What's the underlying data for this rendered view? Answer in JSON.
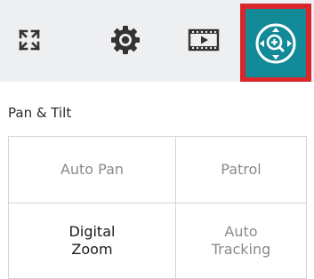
{
  "toolbar": {
    "buttons": [
      {
        "id": "fullscreen",
        "icon": "fullscreen-icon"
      },
      {
        "id": "settings",
        "icon": "gear-icon"
      },
      {
        "id": "video",
        "icon": "video-player-icon"
      },
      {
        "id": "ptz",
        "icon": "ptz-zoom-icon",
        "selected": true
      }
    ],
    "colors": {
      "background": "#edeff0",
      "icon": "#333333",
      "selected_fill": "#128a98",
      "selected_border": "#d9262c"
    }
  },
  "panel": {
    "title": "Pan & Tilt",
    "options": [
      {
        "label": "Auto Pan",
        "enabled": false
      },
      {
        "label": "Patrol",
        "enabled": false
      },
      {
        "label": "Digital\nZoom",
        "enabled": true
      },
      {
        "label": "Auto\nTracking",
        "enabled": false
      }
    ]
  }
}
